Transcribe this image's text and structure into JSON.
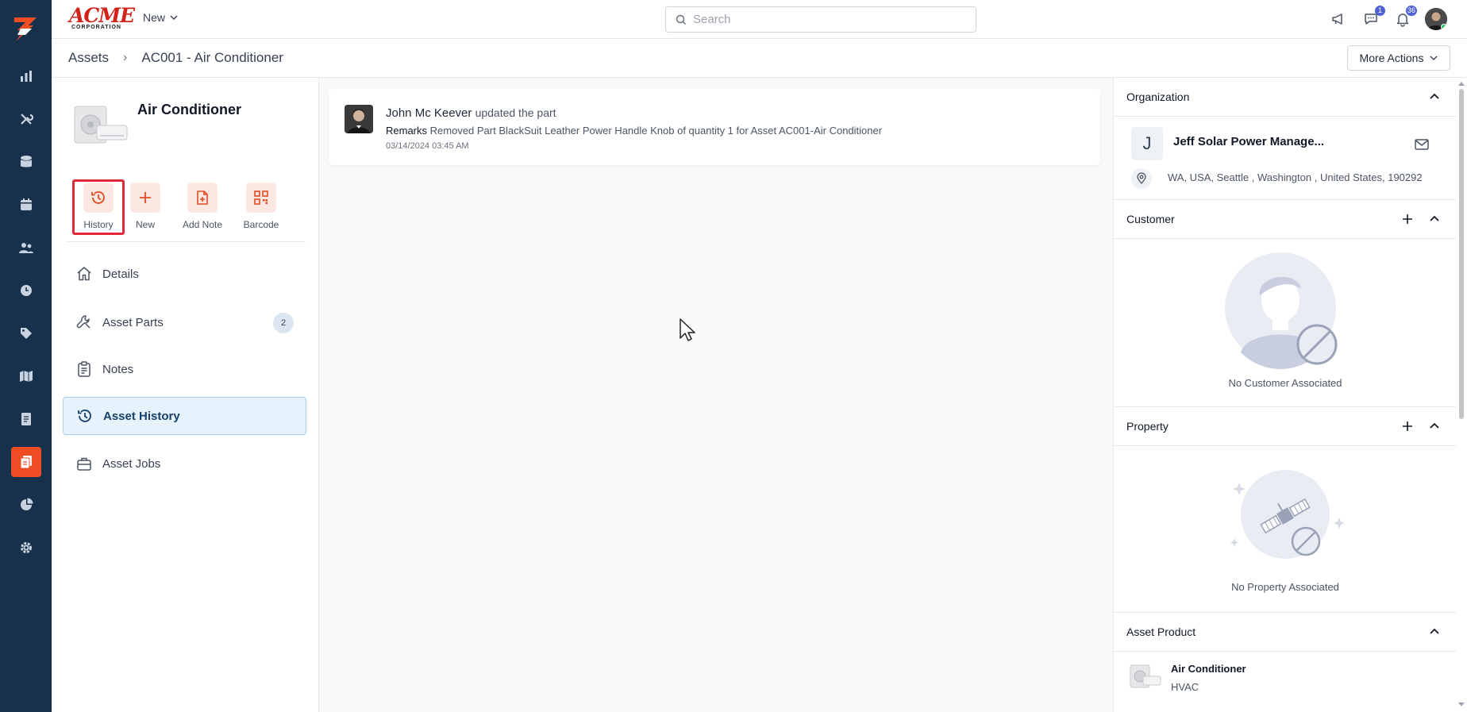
{
  "topbar": {
    "brand_main": "ACME",
    "brand_sub": "CORPORATION",
    "new_label": "New",
    "search_placeholder": "Search",
    "messages_count": "1",
    "notifications_count": "36"
  },
  "breadcrumb": {
    "root": "Assets",
    "separator": "›",
    "current": "AC001 - Air Conditioner"
  },
  "header": {
    "more_actions_label": "More Actions"
  },
  "asset": {
    "title": "Air Conditioner"
  },
  "quick_actions": [
    {
      "label": "History",
      "icon": "history-icon"
    },
    {
      "label": "New",
      "icon": "plus-icon"
    },
    {
      "label": "Add Note",
      "icon": "add-note-icon"
    },
    {
      "label": "Barcode",
      "icon": "qr-code-icon"
    }
  ],
  "nav": [
    {
      "label": "Details",
      "icon": "home-icon"
    },
    {
      "label": "Asset Parts",
      "icon": "wrench-icon",
      "count": "2"
    },
    {
      "label": "Notes",
      "icon": "clipboard-icon"
    },
    {
      "label": "Asset History",
      "icon": "history-icon"
    },
    {
      "label": "Asset Jobs",
      "icon": "briefcase-icon"
    }
  ],
  "history": [
    {
      "user": "John Mc Keever",
      "action": "updated the part",
      "remarks_label": "Remarks",
      "remarks": "Removed Part BlackSuit Leather Power Handle Knob of quantity 1 for Asset AC001-Air Conditioner",
      "timestamp": "03/14/2024 03:45 AM"
    }
  ],
  "organization": {
    "heading": "Organization",
    "initial": "J",
    "name": "Jeff Solar Power Manage...",
    "address": "WA, USA, Seattle , Washington , United States, 190292"
  },
  "customer": {
    "heading": "Customer",
    "empty_text": "No Customer Associated"
  },
  "property": {
    "heading": "Property",
    "empty_text": "No Property Associated"
  },
  "asset_product": {
    "heading": "Asset Product",
    "name": "Air Conditioner",
    "category": "HVAC"
  },
  "colors": {
    "rail_bg": "#17314d",
    "accent": "#ee4d23",
    "active_nav_bg": "#e6f2fc",
    "selected_outline": "#e0283a"
  }
}
